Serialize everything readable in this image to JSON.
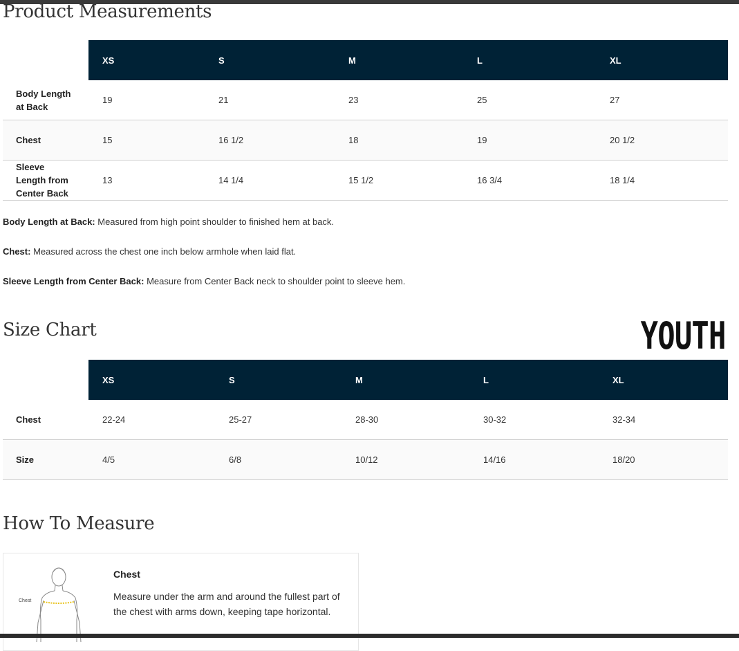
{
  "product_measurements": {
    "title": "Product Measurements",
    "columns": [
      "XS",
      "S",
      "M",
      "L",
      "XL"
    ],
    "rows": [
      {
        "label": "Body Length at Back",
        "values": [
          "19",
          "21",
          "23",
          "25",
          "27"
        ]
      },
      {
        "label": "Chest",
        "values": [
          "15",
          "16 1/2",
          "18",
          "19",
          "20 1/2"
        ]
      },
      {
        "label": "Sleeve Length from Center Back",
        "values": [
          "13",
          "14 1/4",
          "15 1/2",
          "16 3/4",
          "18 1/4"
        ]
      }
    ],
    "definitions": [
      {
        "term": "Body Length at Back:",
        "text": " Measured from high point shoulder to finished hem at back."
      },
      {
        "term": "Chest:",
        "text": " Measured across the chest one inch below armhole when laid flat."
      },
      {
        "term": "Sleeve Length from Center Back:",
        "text": " Measure from Center Back neck to shoulder point to sleeve hem."
      }
    ]
  },
  "size_chart": {
    "title": "Size Chart",
    "badge": "YOUTH",
    "columns": [
      "XS",
      "S",
      "M",
      "L",
      "XL"
    ],
    "rows": [
      {
        "label": "Chest",
        "values": [
          "22-24",
          "25-27",
          "28-30",
          "30-32",
          "32-34"
        ]
      },
      {
        "label": "Size",
        "values": [
          "4/5",
          "6/8",
          "10/12",
          "14/16",
          "18/20"
        ]
      }
    ]
  },
  "how_to_measure": {
    "title": "How To Measure",
    "items": [
      {
        "label": "Chest",
        "figure_label": "Chest",
        "description": "Measure under the arm and around the fullest part of the chest with arms down, keeping tape horizontal."
      }
    ]
  },
  "colors": {
    "header_bg": "#002236",
    "tape": "#e8c21a"
  }
}
